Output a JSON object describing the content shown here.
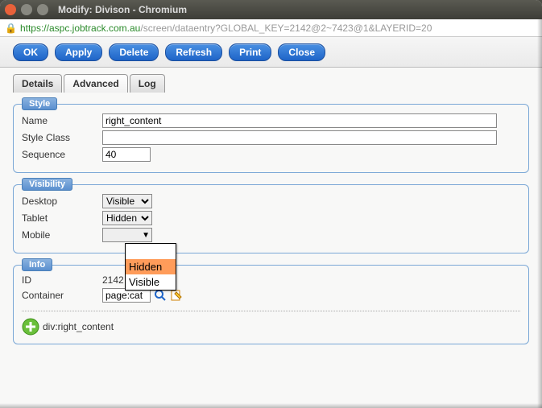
{
  "window": {
    "title": "Modify: Divison - Chromium"
  },
  "url": {
    "scheme": "https",
    "host": "://aspc.jobtrack.com.au",
    "path": "/screen/dataentry?GLOBAL_KEY=2142@2~7423@1&LAYERID=20"
  },
  "toolbar": {
    "ok": "OK",
    "apply": "Apply",
    "delete": "Delete",
    "refresh": "Refresh",
    "print": "Print",
    "close": "Close"
  },
  "tabs": {
    "details": "Details",
    "advanced": "Advanced",
    "log": "Log"
  },
  "style": {
    "legend": "Style",
    "name_label": "Name",
    "name_value": "right_content",
    "class_label": "Style Class",
    "class_value": "",
    "seq_label": "Sequence",
    "seq_value": "40"
  },
  "visibility": {
    "legend": "Visibility",
    "desktop_label": "Desktop",
    "desktop_value": "Visible",
    "tablet_label": "Tablet",
    "tablet_value": "Hidden",
    "mobile_label": "Mobile",
    "mobile_value": "",
    "options": {
      "hidden": "Hidden",
      "visible": "Visible"
    }
  },
  "info": {
    "legend": "Info",
    "id_label": "ID",
    "id_value": "2142",
    "container_label": "Container",
    "container_value": "page:cat",
    "div_text": "div:right_content"
  }
}
